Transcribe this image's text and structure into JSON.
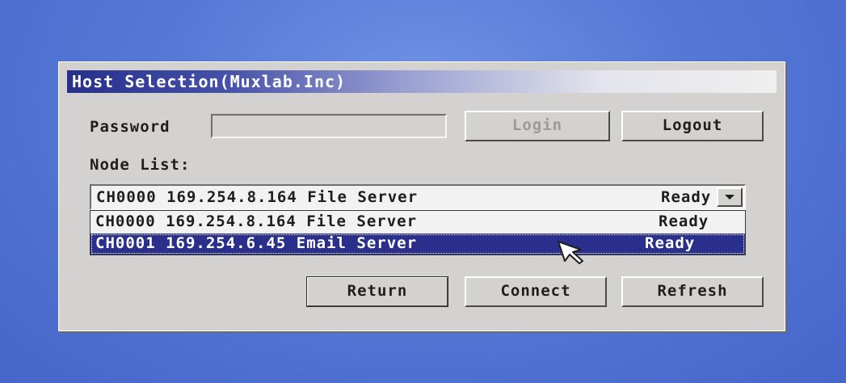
{
  "dialog": {
    "title": "Host Selection(Muxlab.Inc)"
  },
  "password": {
    "label": "Password",
    "value": "",
    "placeholder": ""
  },
  "buttons": {
    "login": "Login",
    "logout": "Logout",
    "return": "Return",
    "connect": "Connect",
    "refresh": "Refresh"
  },
  "node_list": {
    "label": "Node List:",
    "selected": {
      "text": "CH0000 169.254.8.164 File Server",
      "status": "Ready"
    },
    "options": [
      {
        "text": "CH0000 169.254.8.164 File Server",
        "status": "Ready"
      },
      {
        "text": "CH0001 169.254.6.45 Email Server",
        "status": "Ready"
      }
    ]
  },
  "colors": {
    "desktop": "#5578d6",
    "dialog": "#d4d2d0",
    "titlebar_start": "#26308c",
    "selection": "#2a2f8c"
  },
  "icons": {
    "combo_arrow": "chevron-down-icon",
    "cursor": "mouse-pointer-icon"
  }
}
